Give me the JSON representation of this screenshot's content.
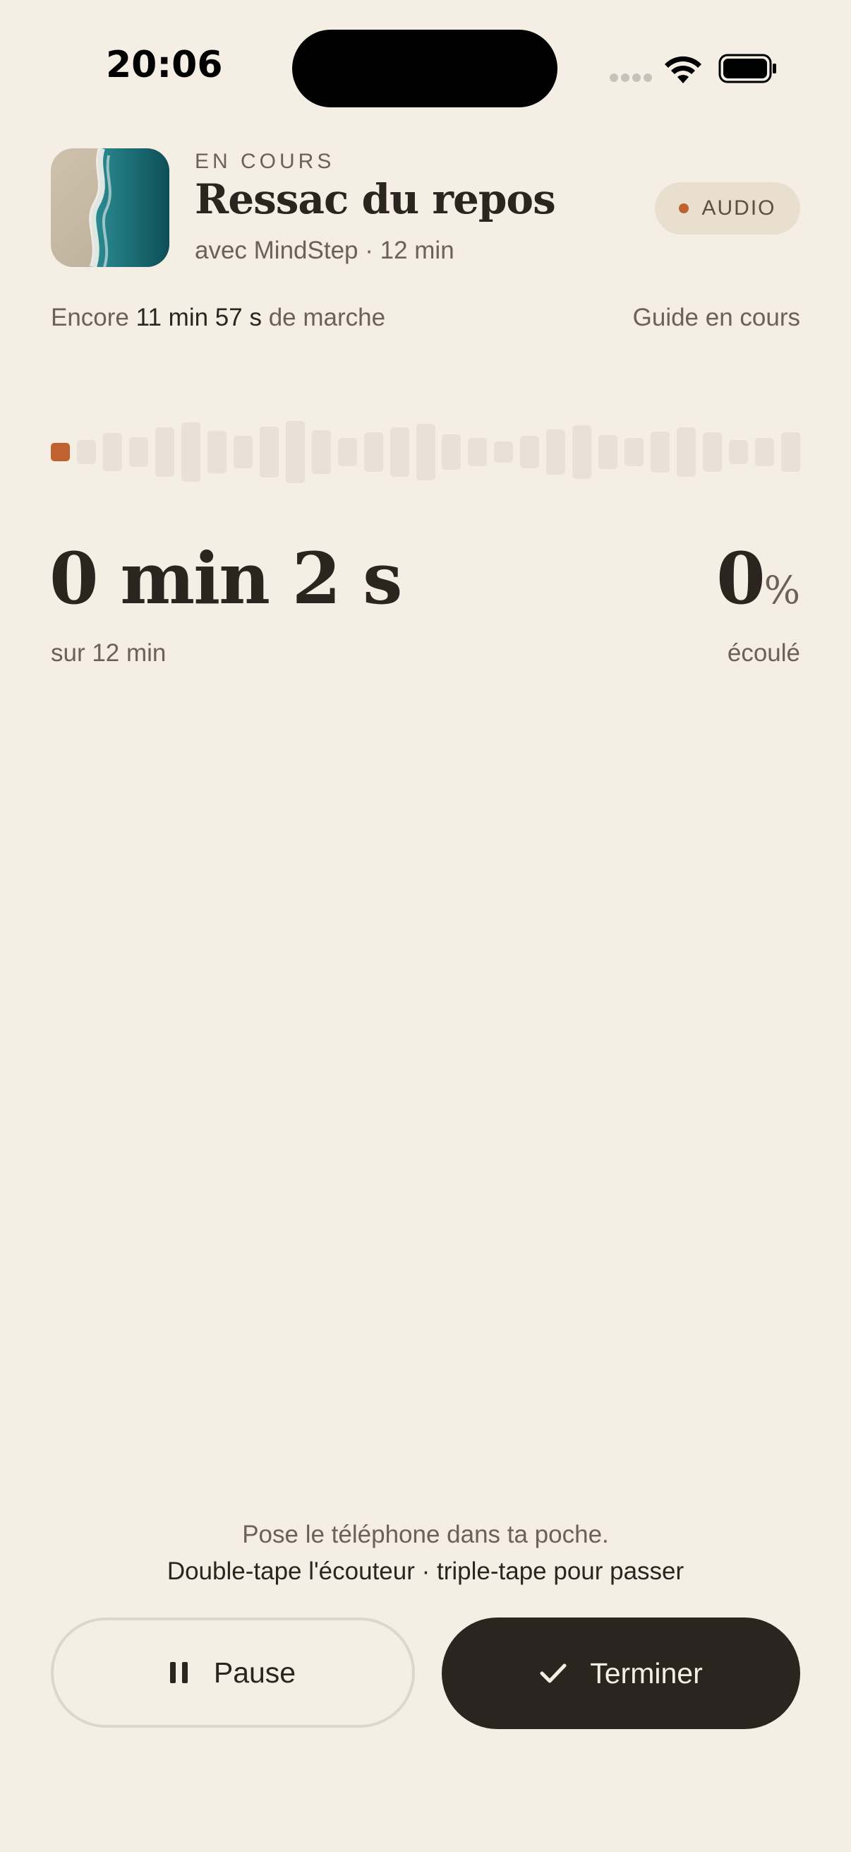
{
  "status_bar": {
    "time": "20:06"
  },
  "session": {
    "eyebrow": "EN COURS",
    "title": "Ressac du repos",
    "subtitle": "avec MindStep · 12 min",
    "badge": "AUDIO"
  },
  "remaining": {
    "prefix": "Encore ",
    "value": "11 min 57 s",
    "suffix": " de marche",
    "guide_status": "Guide en cours"
  },
  "progress": {
    "elapsed": "0 min 2 s",
    "elapsed_sub": "sur 12 min",
    "percent_value": "0",
    "percent_sign": "%",
    "percent_sub": "écoulé",
    "fraction_complete": 0.003
  },
  "hint": {
    "line1": "Pose le téléphone dans ta poche.",
    "line2": "Double-tape l'écouteur · triple-tape pour passer"
  },
  "controls": {
    "pause_label": "Pause",
    "finish_label": "Terminer"
  },
  "colors": {
    "background": "#f4eee5",
    "accent": "#c0622f",
    "text_primary": "#2c241f",
    "text_secondary": "#6b6158",
    "waveform_unplayed": "#e9e1d6"
  },
  "icons": {
    "pause": "pause-icon",
    "finish": "check-icon",
    "wifi": "wifi-icon",
    "battery": "battery-icon"
  }
}
